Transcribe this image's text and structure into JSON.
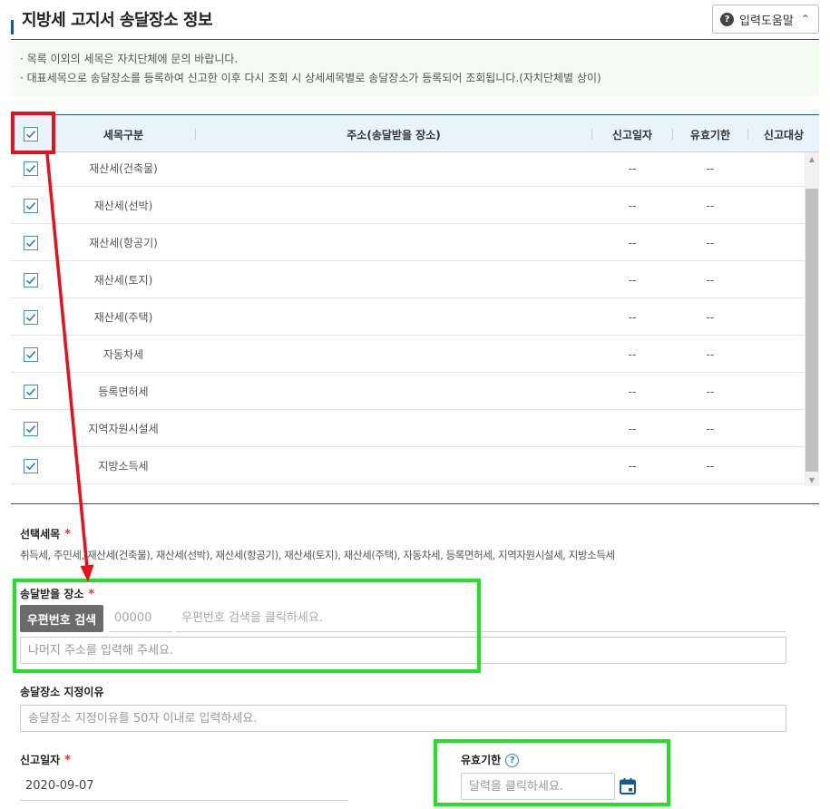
{
  "header": {
    "title": "지방세 고지서 송달장소 정보",
    "help_label": "입력도움말"
  },
  "notice": {
    "lines": [
      "· 목록 이외의 세목은 자치단체에 문의 바랍니다.",
      "· 대표세목으로 송달장소를 등록하여 신고한 이후 다시 조회 시 상세세목별로 송달장소가 등록되어 조회됩니다.(자치단체별 상이)"
    ]
  },
  "table": {
    "columns": [
      "세목구분",
      "주소(송달받을 장소)",
      "신고일자",
      "유효기한",
      "신고대상"
    ],
    "select_all_checked": true,
    "rows": [
      {
        "checked": true,
        "tax": "재산세(건축물)",
        "address": "",
        "report_date": "--",
        "expiry": "--",
        "target": ""
      },
      {
        "checked": true,
        "tax": "재산세(선박)",
        "address": "",
        "report_date": "--",
        "expiry": "--",
        "target": ""
      },
      {
        "checked": true,
        "tax": "재산세(항공기)",
        "address": "",
        "report_date": "--",
        "expiry": "--",
        "target": ""
      },
      {
        "checked": true,
        "tax": "재산세(토지)",
        "address": "",
        "report_date": "--",
        "expiry": "--",
        "target": ""
      },
      {
        "checked": true,
        "tax": "재산세(주택)",
        "address": "",
        "report_date": "--",
        "expiry": "--",
        "target": ""
      },
      {
        "checked": true,
        "tax": "자동차세",
        "address": "",
        "report_date": "--",
        "expiry": "--",
        "target": ""
      },
      {
        "checked": true,
        "tax": "등록면허세",
        "address": "",
        "report_date": "--",
        "expiry": "--",
        "target": ""
      },
      {
        "checked": true,
        "tax": "지역자원시설세",
        "address": "",
        "report_date": "--",
        "expiry": "--",
        "target": ""
      },
      {
        "checked": true,
        "tax": "지방소득세",
        "address": "",
        "report_date": "--",
        "expiry": "--",
        "target": ""
      }
    ]
  },
  "form": {
    "selected_tax_label": "선택세목",
    "selected_tax_value": "취득세, 주민세, 재산세(건축물), 재산세(선박), 재산세(항공기), 재산세(토지), 재산세(주택), 자동차세, 등록면허세, 지역자원시설세, 지방소득세",
    "address_label": "송달받을 장소",
    "zip_button": "우편번호 검색",
    "zip_placeholder": "00000",
    "address1_placeholder": "우편번호 검색을 클릭하세요.",
    "address2_placeholder": "나머지 주소를 입력해 주세요.",
    "reason_label": "송달장소 지정이유",
    "reason_placeholder": "송달장소 지정이유를 50자 이내로 입력하세요.",
    "report_date_label": "신고일자",
    "report_date_value": "2020-09-07",
    "expiry_label": "유효기한",
    "expiry_placeholder": "달력을 클릭하세요."
  },
  "required_mark": "*",
  "icons": {
    "help": "question-circle-icon",
    "collapse": "chevron-up-icon",
    "checkbox": "check-icon",
    "calendar": "calendar-icon"
  },
  "colors": {
    "accent": "#1a5a8a",
    "highlight_red": "#e8101a",
    "highlight_green": "#22e022",
    "required": "#e33333"
  }
}
